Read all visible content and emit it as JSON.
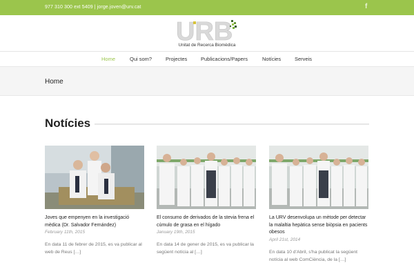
{
  "topbar": {
    "contact": "977 310 300 ext 5409  |  jorge.joven@urv.cat",
    "facebook_glyph": "f",
    "facebook_icon": "facebook-icon",
    "background": "#9bc54c"
  },
  "logo": {
    "letters": "URB",
    "name": "Unitat de Recerca Biomèdica"
  },
  "nav": {
    "items": [
      {
        "label": "Home",
        "active": true
      },
      {
        "label": "Qui som?"
      },
      {
        "label": "Projectes"
      },
      {
        "label": "Publicacions/Papers"
      },
      {
        "label": "Notícies"
      },
      {
        "label": "Serveis"
      }
    ],
    "active_color": "#9bc54c"
  },
  "page": {
    "breadcrumb": "Home"
  },
  "section": {
    "title": "Notícies"
  },
  "posts": [
    {
      "title": "Joves que empenyen en la investigació mèdica (Dr. Salvador Fernández)",
      "date": "February 11th, 2015",
      "excerpt": "En data 11 de febrer de 2015, es va publicar al web de Reus […]"
    },
    {
      "title": "El consumo de derivados de la stevia frena el cúmulo de grasa en el hígado",
      "date": "January 19th, 2015",
      "excerpt": "En data 14 de gener de 2015, es va publicar la següent notícia al […]"
    },
    {
      "title": "La URV desenvolupa un mètode per detectar la malaltia hepàtica sense biòpsia en pacients obesos",
      "date": "April 21st, 2014",
      "excerpt": "En data 10 d'Abril, s'ha publicat la següent notícia al web ComCiència, de la […]"
    }
  ]
}
